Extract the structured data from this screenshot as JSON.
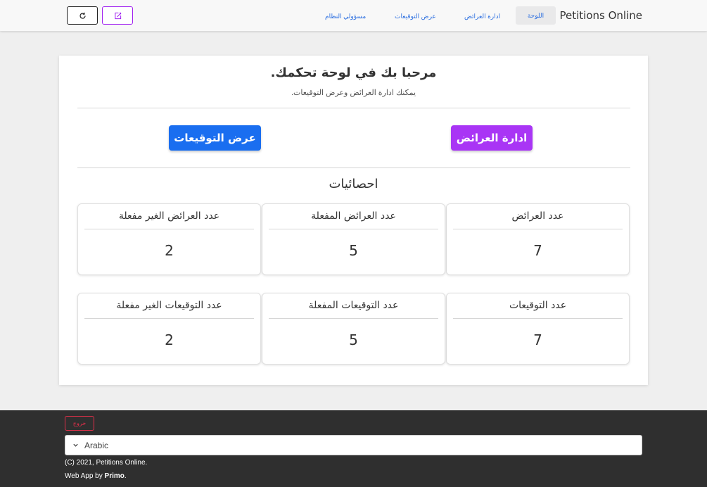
{
  "navbar": {
    "brand": "Petitions Online",
    "links": [
      {
        "label": "اللوحة",
        "active": true
      },
      {
        "label": "ادارة العرائض",
        "active": false
      },
      {
        "label": "عرض التوقيعات",
        "active": false
      },
      {
        "label": "مسؤولي النظام",
        "active": false
      }
    ],
    "buttons": [
      {
        "icon": "edit-icon",
        "color": "#a020f0"
      },
      {
        "icon": "refresh-icon",
        "color": "#222222"
      }
    ]
  },
  "dashboard": {
    "title": "مرحبا بك في لوحة تحكمك.",
    "subtitle": "يمكنك ادارة العرائض وعرض التوقيعات.",
    "actions": {
      "manage_label": "ادارة العرائض",
      "manage_color": "#a935f5",
      "view_label": "عرض التوقيعات",
      "view_color": "#1a6ef0"
    },
    "stats_title": "احصائيات",
    "stats": [
      {
        "label": "عدد العرائض",
        "value": "7"
      },
      {
        "label": "عدد العرائض المفعلة",
        "value": "5"
      },
      {
        "label": "عدد العرائض الغير مفعلة",
        "value": "2"
      },
      {
        "label": "عدد التوقيعات",
        "value": "7"
      },
      {
        "label": "عدد التوقيعات المفعلة",
        "value": "5"
      },
      {
        "label": "عدد التوقيعات الغير مفعلة",
        "value": "2"
      }
    ]
  },
  "footer": {
    "logout_label": "خروج",
    "language_selected": "Arabic",
    "copyright": "(C) 2021, Petitions Online.",
    "credit_prefix": "Web App by ",
    "credit_name": "Primo",
    "credit_suffix": "."
  }
}
